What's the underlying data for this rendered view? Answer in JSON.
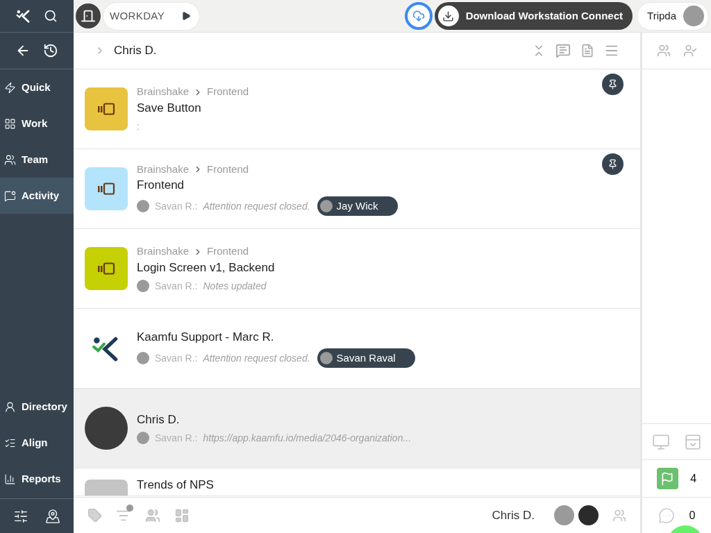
{
  "topbar": {
    "workday": "WORKDAY",
    "download_button": "Download Workstation Connect",
    "user_name": "Tripda"
  },
  "sidebar": {
    "nav": [
      {
        "label": "Quick",
        "selected": false
      },
      {
        "label": "Work",
        "selected": false
      },
      {
        "label": "Team",
        "selected": false
      },
      {
        "label": "Activity",
        "selected": true
      }
    ],
    "bottom_nav": [
      {
        "label": "Directory",
        "selected": false
      },
      {
        "label": "Align",
        "selected": false
      },
      {
        "label": "Reports",
        "selected": false
      }
    ]
  },
  "header": {
    "title": "Chris D."
  },
  "feed": [
    {
      "kind": "task",
      "color": "#e8c33f",
      "breadcrumb": [
        "Brainshake",
        "Frontend"
      ],
      "title": "Save Button",
      "note": ":",
      "pinned": true,
      "selected": false
    },
    {
      "kind": "task",
      "color": "#b3e4fb",
      "breadcrumb": [
        "Brainshake",
        "Frontend"
      ],
      "title": "Frontend",
      "author": "Savan R.:",
      "message": "Attention request closed.",
      "tag": "Jay Wick",
      "pinned": true,
      "selected": false
    },
    {
      "kind": "task",
      "color": "#c5d005",
      "breadcrumb": [
        "Brainshake",
        "Frontend"
      ],
      "title": "Login Screen v1, Backend",
      "author": "Savan R.:",
      "message": "Notes updated",
      "pinned": false,
      "selected": false
    },
    {
      "kind": "logo",
      "title": "Kaamfu Support - Marc R.",
      "author": "Savan R.:",
      "message": "Attention request closed.",
      "tag": "Savan Raval",
      "pinned": false,
      "selected": false
    },
    {
      "kind": "person",
      "title": "Chris D.",
      "author": "Savan R.:",
      "message": "https://app.kaamfu.io/media/2046-organization...",
      "pinned": false,
      "selected": true
    },
    {
      "kind": "placeholder",
      "title": "Trends of NPS",
      "pinned": false,
      "selected": false
    }
  ],
  "footer": {
    "name": "Chris D."
  },
  "right_panel": {
    "flags": "4",
    "comments": "0"
  }
}
